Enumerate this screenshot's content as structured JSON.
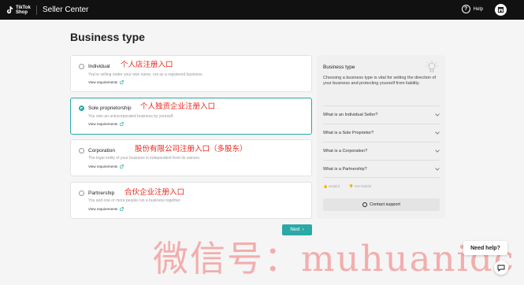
{
  "header": {
    "logo_text": "TikTok Shop",
    "app_title": "Seller Center",
    "help_label": "Help"
  },
  "page": {
    "title": "Business type"
  },
  "options": [
    {
      "name": "Individual",
      "cn_note": "个人店注册入口",
      "description": "You're selling under your own name, not as a registered business.",
      "requirements": "View requirements",
      "selected": false
    },
    {
      "name": "Sole proprietorship",
      "cn_note": "个人独资企业注册入口",
      "description": "You own an unincorporated business by yourself.",
      "requirements": "View requirements",
      "selected": true
    },
    {
      "name": "Corporation",
      "cn_note": "股份有限公司注册入口（多股东）",
      "description": "The legal entity of your business is independent from its owners.",
      "requirements": "View requirements",
      "selected": false
    },
    {
      "name": "Partnership",
      "cn_note": "合伙企业注册入口",
      "description": "You and one or more people run a business together.",
      "requirements": "View requirements",
      "selected": false
    }
  ],
  "sidebar": {
    "title": "Business type",
    "description": "Choosing a business type is vital for setting the direction of your business and protecting yourself from liability.",
    "faqs": [
      "What is an Individual Seller?",
      "What is a Sole Proprietor?",
      "What is a Corporation?",
      "What is a Partnership?"
    ],
    "helpful_label": "Helpful",
    "not_helpful_label": "Not helpful",
    "contact_label": "Contact support"
  },
  "actions": {
    "next_label": "Next"
  },
  "watermark": "微信号：muhuanidc",
  "support_widget": {
    "label": "Need help?"
  },
  "colors": {
    "accent": "#2aa9a7",
    "annotation": "#e8281e",
    "topbar": "#111111"
  }
}
